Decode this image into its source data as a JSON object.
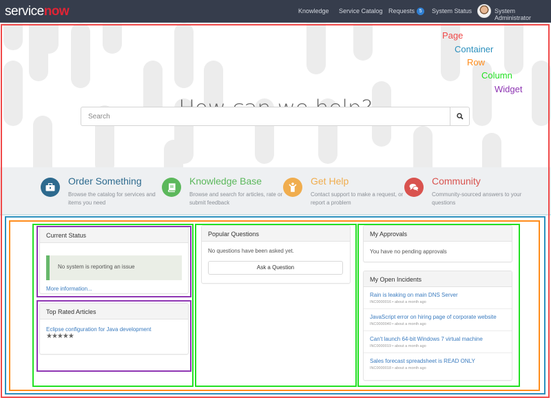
{
  "header": {
    "logo_service": "service",
    "logo_now": "now",
    "nav": [
      {
        "label": "Knowledge"
      },
      {
        "label": "Service Catalog"
      },
      {
        "label": "Requests",
        "badge": "5"
      },
      {
        "label": "System Status"
      }
    ],
    "user_name": "System Administrator"
  },
  "hero": {
    "title": "How can we help?",
    "search_placeholder": "Search",
    "search_value": ""
  },
  "quick_links": [
    {
      "title": "Order Something",
      "description": "Browse the catalog for services and items you need",
      "icon": "briefcase-icon",
      "color": "#2d6a8e"
    },
    {
      "title": "Knowledge Base",
      "description": "Browse and search for articles, rate or submit feedback",
      "icon": "book-icon",
      "color": "#5cb85c"
    },
    {
      "title": "Get Help",
      "description": "Contact support to make a request, or report a problem",
      "icon": "person-help-icon",
      "color": "#f0ad4e"
    },
    {
      "title": "Community",
      "description": "Community-sourced answers to your questions",
      "icon": "chat-bubbles-icon",
      "color": "#d9534f"
    }
  ],
  "legend": [
    {
      "label": "Page",
      "color": "#f04848"
    },
    {
      "label": "Container",
      "color": "#2a8fbd"
    },
    {
      "label": "Row",
      "color": "#ff8c1a"
    },
    {
      "label": "Column",
      "color": "#22e022"
    },
    {
      "label": "Widget",
      "color": "#8e35b3"
    }
  ],
  "widgets": {
    "current_status": {
      "title": "Current Status",
      "message": "No system is reporting an issue",
      "more_link": "More information..."
    },
    "top_rated": {
      "title": "Top Rated Articles",
      "articles": [
        {
          "title": "Eclipse configuration for Java development",
          "rating": 5,
          "stars": "★★★★★"
        }
      ]
    },
    "popular_questions": {
      "title": "Popular Questions",
      "empty_text": "No questions have been asked yet.",
      "button": "Ask a Question"
    },
    "my_approvals": {
      "title": "My Approvals",
      "empty_text": "You have no pending approvals"
    },
    "my_incidents": {
      "title": "My Open Incidents",
      "items": [
        {
          "title": "Rain is leaking on main DNS Server",
          "meta": "INC0000016 • about a month ago"
        },
        {
          "title": "JavaScript error on hiring page of corporate website",
          "meta": "INC0000040 • about a month ago"
        },
        {
          "title": "Can't launch 64-bit Windows 7 virtual machine",
          "meta": "INC0000019 • about a month ago"
        },
        {
          "title": "Sales forecast spreadsheet is READ ONLY",
          "meta": "INC0000018 • about a month ago"
        }
      ]
    }
  }
}
